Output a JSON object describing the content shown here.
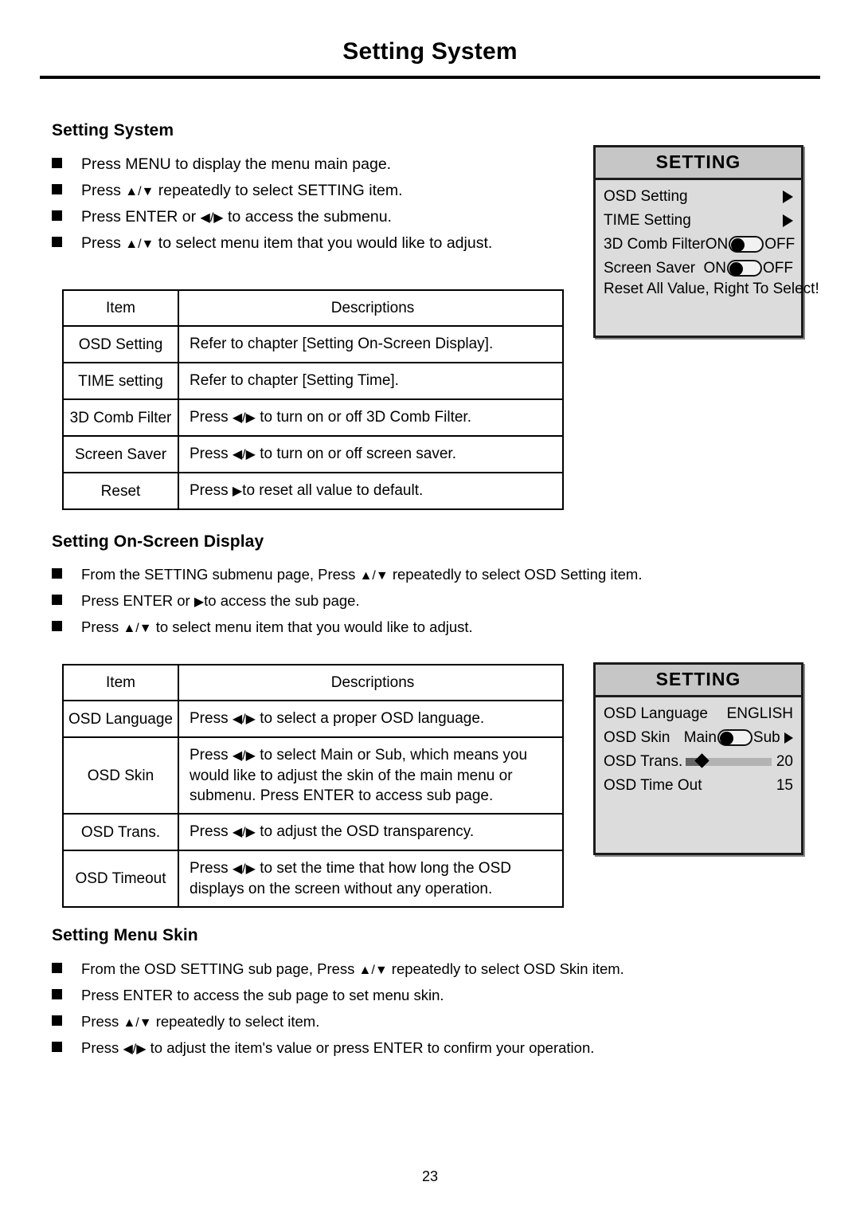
{
  "page": {
    "running_header": "Setting System",
    "page_number": "23"
  },
  "sections": {
    "setting_system": {
      "heading": "Setting System",
      "bullets": [
        {
          "prefix": "Press MENU to display the menu main page.",
          "glyph": "",
          "suffix": ""
        },
        {
          "prefix": "Press ",
          "glyph": "▲/▼",
          "suffix": " repeatedly to select SETTING item."
        },
        {
          "prefix": "Press ENTER or ",
          "glyph": "◀/▶",
          "suffix": "  to access the submenu."
        },
        {
          "prefix": "Press ",
          "glyph": "▲/▼",
          "suffix": " to select menu item that you would like to adjust."
        }
      ],
      "table": {
        "headers": [
          "Item",
          "Descriptions"
        ],
        "rows": [
          {
            "item": "OSD Setting",
            "desc_prefix": "Refer to chapter [Setting On-Screen Display].",
            "glyph": "",
            "desc_suffix": ""
          },
          {
            "item": "TIME setting",
            "desc_prefix": "Refer to chapter [Setting Time].",
            "glyph": "",
            "desc_suffix": ""
          },
          {
            "item": "3D Comb Filter",
            "desc_prefix": "Press ",
            "glyph": "◀/▶",
            "desc_suffix": " to turn on or off 3D Comb Filter."
          },
          {
            "item": "Screen Saver",
            "desc_prefix": "Press ",
            "glyph": "◀/▶",
            "desc_suffix": " to turn on or off screen saver."
          },
          {
            "item": "Reset",
            "desc_prefix": "Press ",
            "glyph": "▶",
            "desc_suffix": "to reset all value to default."
          }
        ]
      }
    },
    "setting_osd": {
      "heading": "Setting On-Screen Display",
      "bullets": [
        {
          "prefix": "From the SETTING submenu page, Press ",
          "glyph": "▲/▼",
          "suffix": " repeatedly to select OSD Setting item."
        },
        {
          "prefix": "Press ENTER or ",
          "glyph": "▶",
          "suffix": "to access the sub page."
        },
        {
          "prefix": "Press ",
          "glyph": "▲/▼",
          "suffix": " to select menu item that you would like to adjust."
        }
      ],
      "table": {
        "headers": [
          "Item",
          "Descriptions"
        ],
        "rows": [
          {
            "item": "OSD Language",
            "desc_prefix": "Press ",
            "glyph": "◀/▶",
            "desc_suffix": " to select a proper OSD language."
          },
          {
            "item": "OSD Skin",
            "desc_prefix": "Press ",
            "glyph": "◀/▶",
            "desc_suffix": " to select Main or Sub, which means you would like to adjust the skin of the main menu or submenu. Press ENTER to access sub page."
          },
          {
            "item": "OSD Trans.",
            "desc_prefix": "Press ",
            "glyph": "◀/▶",
            "desc_suffix": " to adjust the OSD transparency."
          },
          {
            "item": "OSD Timeout",
            "desc_prefix": "Press ",
            "glyph": "◀/▶",
            "desc_suffix": " to set the time that how long the OSD displays on the screen without any operation."
          }
        ]
      }
    },
    "setting_menu_skin": {
      "heading": "Setting Menu Skin",
      "bullets": [
        {
          "prefix": "From the OSD SETTING sub page, Press ",
          "glyph": "▲/▼",
          "suffix": " repeatedly to select OSD Skin item."
        },
        {
          "prefix": "Press ENTER to access the sub page to set menu skin.",
          "glyph": "",
          "suffix": ""
        },
        {
          "prefix": "Press ",
          "glyph": "▲/▼",
          "suffix": " repeatedly to select item."
        },
        {
          "prefix": "Press ",
          "glyph": "◀/▶",
          "suffix": " to adjust the item's value or press ENTER to confirm your operation."
        }
      ]
    }
  },
  "osd_main": {
    "title": "SETTING",
    "rows": [
      {
        "label": "OSD Setting",
        "value": "",
        "control": "arrow"
      },
      {
        "label": "TIME Setting",
        "value": "",
        "control": "arrow"
      },
      {
        "label": "3D Comb Filter",
        "on_label": "ON",
        "off_label": "OFF",
        "control": "toggle",
        "state": "on"
      },
      {
        "label": "Screen Saver",
        "on_label": "ON",
        "off_label": "OFF",
        "control": "toggle",
        "state": "on"
      },
      {
        "label": "Reset All Value, Right To Select!",
        "value": "",
        "control": "none"
      }
    ]
  },
  "osd_sub": {
    "title": "SETTING",
    "rows": [
      {
        "label": "OSD Language",
        "value": "ENGLISH",
        "control": "text"
      },
      {
        "label": "OSD Skin",
        "left_label": "Main",
        "right_label": "Sub",
        "control": "toggle-arrow",
        "state": "main"
      },
      {
        "label": "OSD Trans.",
        "value": "20",
        "control": "slider",
        "slider_percent": 16
      },
      {
        "label": "OSD Time Out",
        "value": "15",
        "control": "text"
      }
    ]
  },
  "colors": {
    "osd_body": "#dcdcdc",
    "osd_title": "#c6c6c6",
    "border": "#1c1c1c",
    "text": "#000000"
  }
}
